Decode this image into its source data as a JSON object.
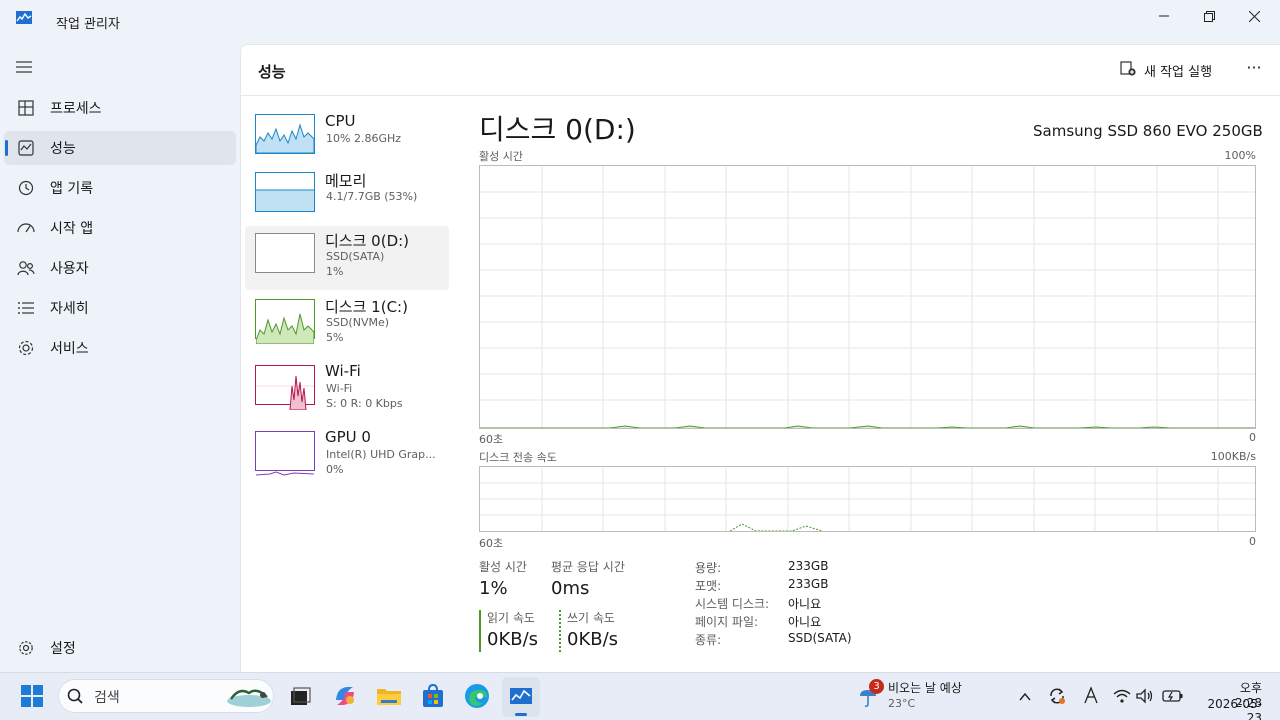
{
  "window": {
    "title": "작업 관리자",
    "controls": [
      "minimize-icon",
      "maximize-icon",
      "close-icon"
    ]
  },
  "nav": {
    "items": [
      {
        "label": "프로세스",
        "icon": "processes-icon"
      },
      {
        "label": "성능",
        "icon": "performance-icon",
        "active": true
      },
      {
        "label": "앱 기록",
        "icon": "history-icon"
      },
      {
        "label": "시작 앱",
        "icon": "startup-icon"
      },
      {
        "label": "사용자",
        "icon": "users-icon"
      },
      {
        "label": "자세히",
        "icon": "details-icon"
      },
      {
        "label": "서비스",
        "icon": "services-icon"
      }
    ],
    "settings_label": "설정"
  },
  "header": {
    "title": "성능",
    "run_task_label": "새 작업 실행",
    "more_label": "···"
  },
  "devices": [
    {
      "name": "CPU",
      "line2": "10% 2.86GHz",
      "line3": "",
      "color": "#1c86c8"
    },
    {
      "name": "메모리",
      "line2": "4.1/7.7GB (53%)",
      "line3": "",
      "color": "#1c86c8"
    },
    {
      "name": "디스크 0(D:)",
      "line2": "SSD(SATA)",
      "line3": "1%",
      "color": "#4c9a2a",
      "active": true
    },
    {
      "name": "디스크 1(C:)",
      "line2": "SSD(NVMe)",
      "line3": "5%",
      "color": "#4c9a2a"
    },
    {
      "name": "Wi-Fi",
      "line2": "Wi-Fi",
      "line3": "S: 0 R: 0 Kbps",
      "color": "#b3194a"
    },
    {
      "name": "GPU 0",
      "line2": "Intel(R) UHD Grap...",
      "line3": "0%",
      "color": "#7a3fb8"
    }
  ],
  "disk": {
    "title": "디스크 0(D:)",
    "model": "Samsung SSD 860 EVO 250GB",
    "active_chart": {
      "label": "활성 시간",
      "max_label": "100%",
      "x_left": "60초",
      "x_right": "0"
    },
    "transfer_chart": {
      "label": "디스크 전송 속도",
      "max_label": "100KB/s",
      "x_left": "60초",
      "x_right": "0"
    },
    "stats": {
      "active_time_label": "활성 시간",
      "active_time_value": "1%",
      "avg_response_label": "평균 응답 시간",
      "avg_response_value": "0ms",
      "read_label": "읽기 속도",
      "read_value": "0KB/s",
      "write_label": "쓰기 속도",
      "write_value": "0KB/s"
    },
    "props": [
      {
        "k": "용량:",
        "v": "233GB"
      },
      {
        "k": "포맷:",
        "v": "233GB"
      },
      {
        "k": "시스템 디스크:",
        "v": "아니요"
      },
      {
        "k": "페이지 파일:",
        "v": "아니요"
      },
      {
        "k": "종류:",
        "v": "SSD(SATA)"
      }
    ],
    "accent_color": "#4c9a2a"
  },
  "taskbar": {
    "search_placeholder": "검색",
    "weather_line1": "비오는 날 예상",
    "weather_line2": "23°C",
    "weather_badge": "3",
    "time": "오후 2:28",
    "date": "2026-05-23"
  }
}
